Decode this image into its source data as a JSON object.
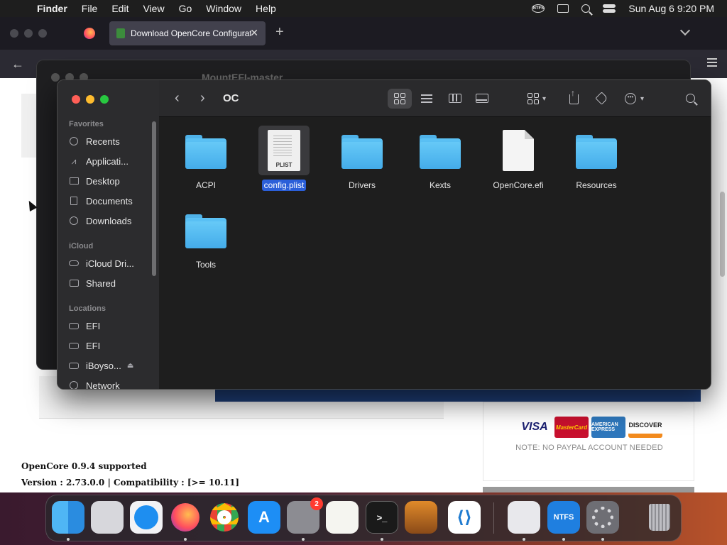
{
  "menubar": {
    "app_name": "Finder",
    "items": [
      "File",
      "Edit",
      "View",
      "Go",
      "Window",
      "Help"
    ],
    "ntfs_label": "NTFS",
    "clock": "Sun Aug 6  9:20 PM"
  },
  "browser": {
    "tab_title": "Download OpenCore Configurat",
    "close_glyph": "✕",
    "newtab_glyph": "+",
    "back_glyph": "←"
  },
  "webpage": {
    "oc_supported": "OpenCore 0.9.4 supported",
    "version_line": "Version : 2.73.0.0  |  Compatibility : [>= 10.11]",
    "payment_note": "NOTE: NO PAYPAL ACCOUNT NEEDED",
    "payment_logos": [
      "VISA",
      "MasterCard",
      "AMERICAN EXPRESS",
      "DISCOVER"
    ]
  },
  "bg_finder": {
    "title": "MountEFI-master"
  },
  "finder": {
    "title": "OC",
    "sidebar": {
      "favorites_label": "Favorites",
      "favorites": [
        {
          "label": "Recents",
          "icon": "clock-icon"
        },
        {
          "label": "Applicati...",
          "icon": "applications-icon"
        },
        {
          "label": "Desktop",
          "icon": "desktop-icon"
        },
        {
          "label": "Documents",
          "icon": "document-icon"
        },
        {
          "label": "Downloads",
          "icon": "downloads-icon"
        }
      ],
      "icloud_label": "iCloud",
      "icloud": [
        {
          "label": "iCloud Dri...",
          "icon": "cloud-icon"
        },
        {
          "label": "Shared",
          "icon": "shared-folder-icon"
        }
      ],
      "locations_label": "Locations",
      "locations": [
        {
          "label": "EFI",
          "icon": "disk-icon"
        },
        {
          "label": "EFI",
          "icon": "disk-icon"
        },
        {
          "label": "iBoyso...",
          "icon": "disk-icon"
        },
        {
          "label": "Network",
          "icon": "globe-icon"
        }
      ]
    },
    "files": [
      {
        "name": "ACPI",
        "kind": "folder"
      },
      {
        "name": "config.plist",
        "kind": "plist",
        "selected": true,
        "badge": "PLIST"
      },
      {
        "name": "Drivers",
        "kind": "folder"
      },
      {
        "name": "Kexts",
        "kind": "folder"
      },
      {
        "name": "OpenCore.efi",
        "kind": "document"
      },
      {
        "name": "Resources",
        "kind": "folder"
      },
      {
        "name": "Tools",
        "kind": "folder"
      }
    ]
  },
  "dock": {
    "apps": [
      "Finder",
      "Launchpad",
      "Safari",
      "Firefox",
      "Chrome",
      "App Store",
      "System Settings",
      "TextEdit",
      "Terminal",
      "GarageBand",
      "Visual Studio Code",
      "Disk Utility",
      "NTFS",
      "Settings",
      "Trash"
    ],
    "settings_badge": "2",
    "ntfs_label": "NTFS"
  },
  "colors": {
    "selection": "#2b5fd9",
    "folder": "#4fb2e8",
    "close": "#ff5f57",
    "minimize": "#febc2e",
    "zoom": "#28c840"
  }
}
